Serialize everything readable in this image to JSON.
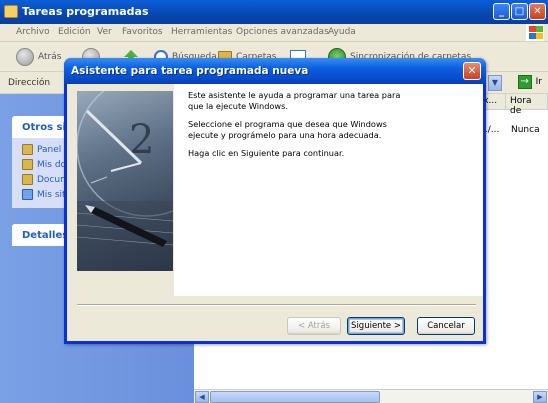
{
  "explorer": {
    "title": "Tareas programadas",
    "menu": [
      "Archivo",
      "Edición",
      "Ver",
      "Favoritos",
      "Herramientas",
      "Opciones avanzadas",
      "Ayuda"
    ],
    "toolbar": {
      "back": "Atrás",
      "search": "Búsqueda",
      "folders": "Carpetas",
      "sync": "Sincronización de carpetas"
    },
    "address": {
      "label": "Dirección",
      "go": "Ir"
    },
    "left_panel": {
      "other_sites": {
        "title": "Otros siti",
        "links": [
          "Panel d",
          "Mis do",
          "Docum",
          "Mis siti"
        ]
      },
      "details": {
        "title": "Detalles"
      }
    },
    "list": {
      "columns": [
        "óx...",
        "Hora de"
      ],
      "row": [
        "1/...",
        "Nunca"
      ]
    }
  },
  "wizard": {
    "title": "Asistente para tarea programada nueva",
    "para1": "Este asistente le ayuda a programar una tarea para\nque la ejecute Windows.",
    "para2": "Seleccione el programa que desea que Windows\nejecute y prográmelo para una hora adecuada.",
    "para3": "Haga clic en Siguiente para continuar.",
    "back_label": "< Atrás",
    "next_label": "Siguiente >",
    "cancel_label": "Cancelar",
    "close_glyph": "✕"
  },
  "colors": {
    "titlebar": "#0a5fe0",
    "dialog_bg": "#ece9d8",
    "link": "#215dc6"
  }
}
